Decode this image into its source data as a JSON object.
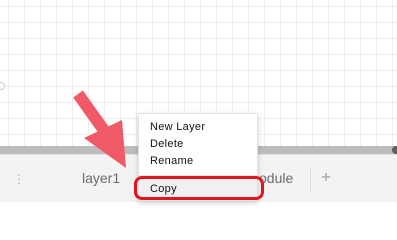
{
  "menu": {
    "items": [
      {
        "label": "New Layer"
      },
      {
        "label": "Delete"
      },
      {
        "label": "Rename"
      },
      {
        "label": "Copy"
      }
    ]
  },
  "tabs": {
    "items": [
      {
        "label": "layer1"
      },
      {
        "label": "odule"
      }
    ],
    "handle_glyph": "⋮",
    "add_glyph": "+"
  },
  "annotation": {
    "arrow_color": "#f05a66",
    "highlight_color": "#e0161e"
  },
  "icons": [
    "drag-handle-icon",
    "add-tab-icon",
    "pointer-arrow-icon"
  ]
}
